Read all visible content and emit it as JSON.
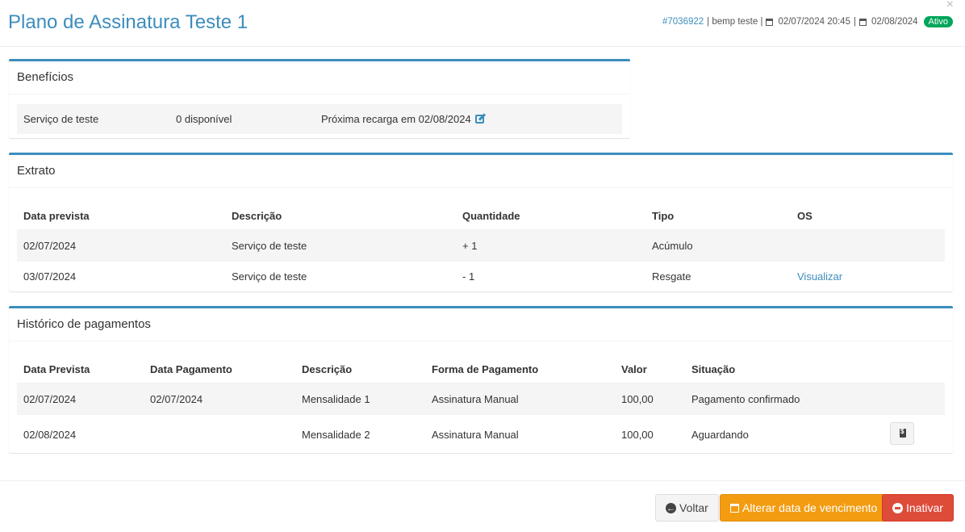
{
  "header": {
    "title": "Plano de Assinatura Teste 1",
    "id_link": "#7036922",
    "customer": "| bemp teste |",
    "start_date": "02/07/2024 20:45",
    "separator": "|",
    "due_date": "02/08/2024",
    "status": "Ativo",
    "status_color": "#00a65a",
    "close_icon": "×"
  },
  "beneficios": {
    "title": "Benefícios",
    "item": {
      "service": "Serviço de teste",
      "available": "0 disponível",
      "next_recharge": "Próxima recarga em 02/08/2024"
    }
  },
  "extrato": {
    "title": "Extrato",
    "columns": [
      "Data prevista",
      "Descrição",
      "Quantidade",
      "Tipo",
      "OS"
    ],
    "rows": [
      {
        "date": "02/07/2024",
        "desc": "Serviço de teste",
        "qty": "+ 1",
        "type": "Acúmulo",
        "os": ""
      },
      {
        "date": "03/07/2024",
        "desc": "Serviço de teste",
        "qty": "- 1",
        "type": "Resgate",
        "os": "Visualizar"
      }
    ]
  },
  "historico": {
    "title": "Histórico de pagamentos",
    "columns": [
      "Data Prevista",
      "Data Pagamento",
      "Descrição",
      "Forma de Pagamento",
      "Valor",
      "Situação"
    ],
    "rows": [
      {
        "due": "02/07/2024",
        "paid": "02/07/2024",
        "desc": "Mensalidade 1",
        "method": "Assinatura Manual",
        "value": "100,00",
        "status": "Pagamento confirmado"
      },
      {
        "due": "02/08/2024",
        "paid": "",
        "desc": "Mensalidade 2",
        "method": "Assinatura Manual",
        "value": "100,00",
        "status": "Aguardando"
      }
    ]
  },
  "footer": {
    "back_label": "Voltar",
    "change_due_label": "Alterar data de vencimento",
    "deactivate_label": "Inativar"
  },
  "colors": {
    "primary": "#3c8dbc",
    "warning": "#f39c12",
    "danger": "#dd4b39"
  }
}
